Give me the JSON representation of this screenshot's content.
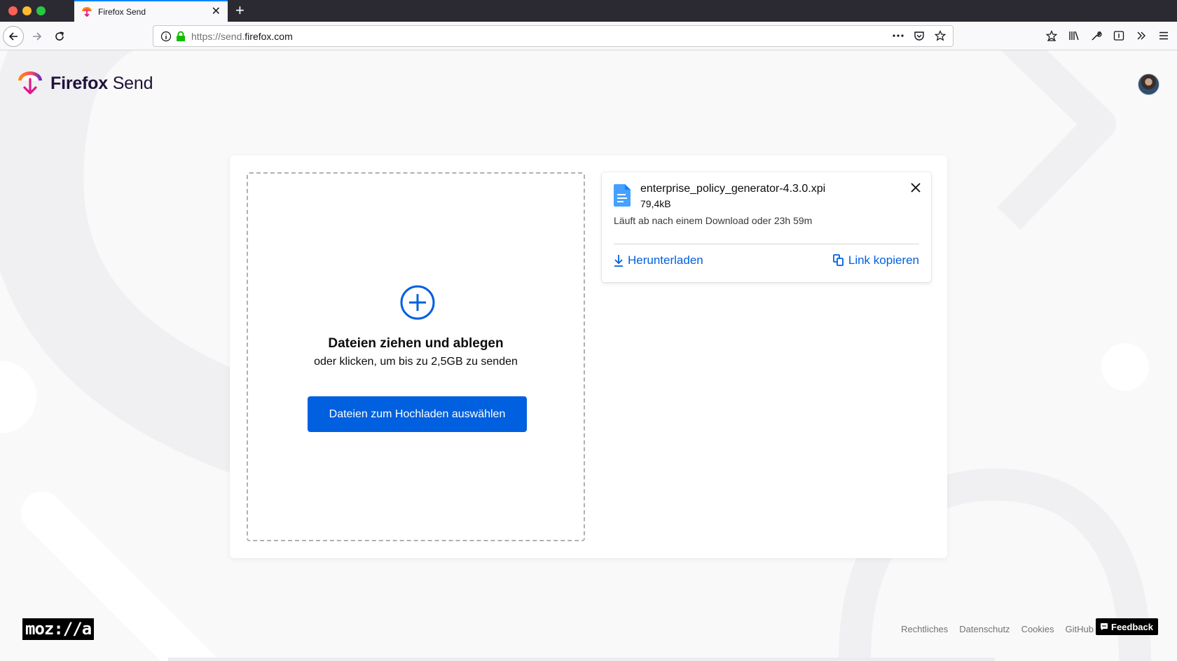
{
  "browser": {
    "tab_title": "Firefox Send",
    "url_scheme": "https://send.",
    "url_domain": "firefox.com"
  },
  "app": {
    "brand_bold": "Firefox",
    "brand_light": " Send"
  },
  "upload": {
    "title": "Dateien ziehen und ablegen",
    "subtitle": "oder klicken, um bis zu 2,5GB zu senden",
    "button_label": "Dateien zum Hochladen auswählen"
  },
  "file": {
    "name": "enterprise_policy_generator-4.3.0.xpi",
    "size": "79,4kB",
    "expiry": "Läuft ab nach einem Download oder 23h 59m",
    "download_label": "Herunterladen",
    "copy_label": "Link kopieren"
  },
  "footer": {
    "logo": "moz://a",
    "links": [
      "Rechtliches",
      "Datenschutz",
      "Cookies",
      "GitHub"
    ],
    "feedback": "Feedback"
  },
  "colors": {
    "accent": "#0060df",
    "background": "#f9f9fa"
  }
}
